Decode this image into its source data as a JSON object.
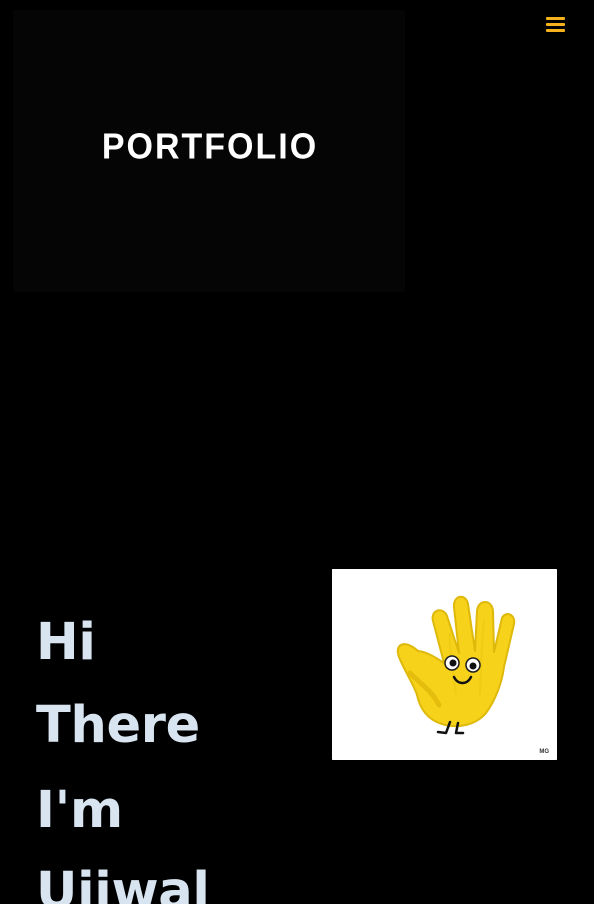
{
  "header": {
    "menu_icon": "hamburger-menu-icon",
    "accent_color": "#f5b21d"
  },
  "banner": {
    "logo_text": "PORTFOLIO",
    "background_color": "#050505"
  },
  "intro": {
    "lines": [
      "Hi",
      "There",
      "I'm",
      "Ujjwal"
    ],
    "text_color": "#d8e5f1"
  },
  "hero_image": {
    "description_icon": "waving-hand-icon",
    "signature": "MG"
  }
}
